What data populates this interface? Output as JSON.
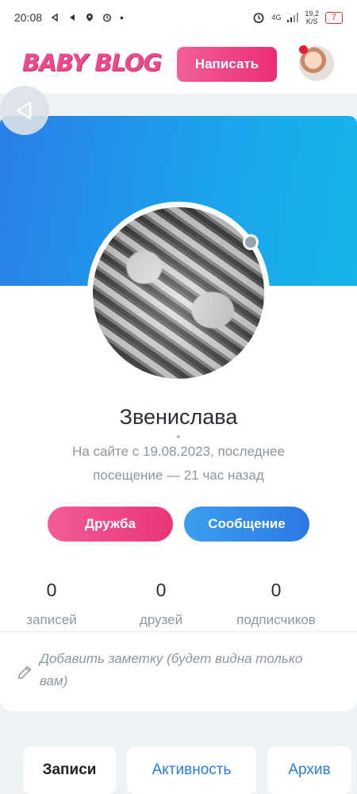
{
  "status_bar": {
    "time": "20:08",
    "network": "4G",
    "speed_value": "19,2",
    "speed_unit": "K/S",
    "battery": "7"
  },
  "header": {
    "logo": "BABY BLOG",
    "write_label": "Написать"
  },
  "profile": {
    "name": "Звенислава",
    "seen_text": "На сайте с 19.08.2023, последнее посещение — 21 час назад",
    "friend_label": "Дружба",
    "message_label": "Сообщение",
    "stats": [
      {
        "value": "0",
        "label": "записей"
      },
      {
        "value": "0",
        "label": "друзей"
      },
      {
        "value": "0",
        "label": "подписчиков"
      }
    ],
    "note_placeholder": "Добавить заметку (будет видна только вам)"
  },
  "tabs": [
    {
      "label": "Записи"
    },
    {
      "label": "Активность"
    },
    {
      "label": "Архив"
    }
  ],
  "colors": {
    "brand_pink": "#ec4a8d",
    "accent_blue": "#2c7be5",
    "cover_start": "#2a7fe8",
    "cover_end": "#16b4ea"
  }
}
